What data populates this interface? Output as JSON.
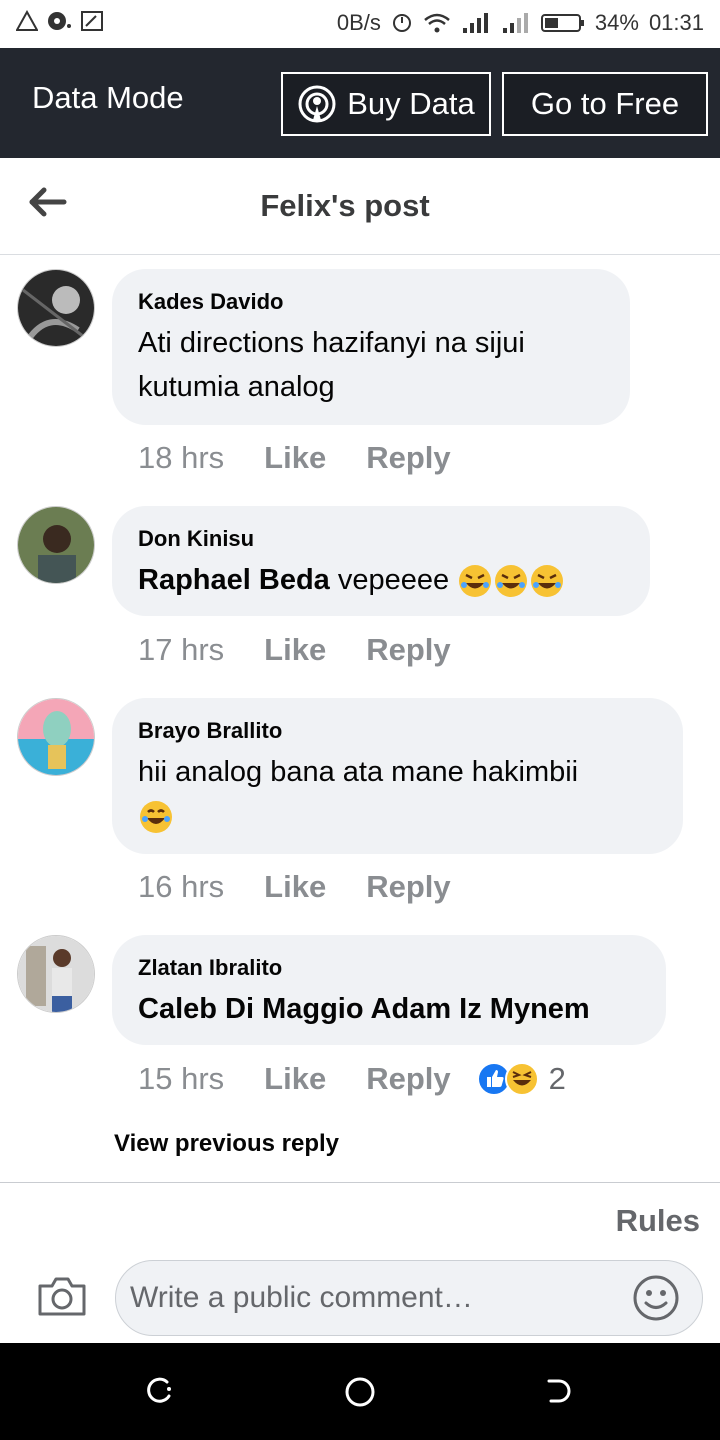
{
  "status_bar": {
    "net_speed": "0B/s",
    "battery": "34%",
    "time": "01:31"
  },
  "data_mode": {
    "title": "Data Mode",
    "buy_label": "Buy Data",
    "free_label": "Go to Free"
  },
  "header": {
    "title": "Felix's post"
  },
  "comments": [
    {
      "name": "Kades Davido",
      "mention": "",
      "text": " Ati directions hazifanyi na sijui kutumia analog",
      "time": "18 hrs",
      "like": "Like",
      "reply": "Reply"
    },
    {
      "name": "Don Kinisu",
      "mention": "Raphael Beda",
      "text": " vepeeee",
      "time": "17 hrs",
      "like": "Like",
      "reply": "Reply"
    },
    {
      "name": "Brayo Brallito",
      "mention": "",
      "text": " hii analog bana ata mane hakimbii",
      "time": "16 hrs",
      "like": "Like",
      "reply": "Reply"
    },
    {
      "name": "Zlatan Ibralito",
      "mention": "Caleb Di Maggio Adam Iz Mynem",
      "text": "",
      "time": "15 hrs",
      "like": "Like",
      "reply": "Reply",
      "reaction_count": "2"
    }
  ],
  "view_previous": "View previous reply",
  "footer": {
    "rules": "Rules",
    "placeholder": "Write a public comment…"
  },
  "icons": {
    "back": "arrow-left-icon",
    "camera": "camera-icon",
    "smiley": "smiley-icon"
  },
  "colors": {
    "data_bar": "#23272f",
    "bubble": "#f0f2f5",
    "meta": "#8a8d91",
    "like_blue": "#1877f2"
  }
}
